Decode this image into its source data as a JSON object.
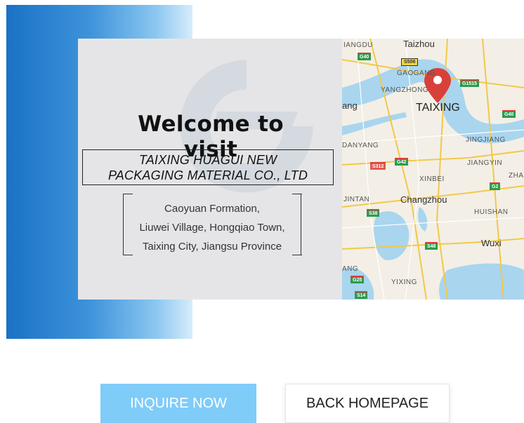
{
  "welcome": {
    "title": "Welcome to visit",
    "company_line1": "TAIXING HUAGUI NEW",
    "company_line2": "PACKAGING MATERIAL CO., LTD",
    "address_line1": "Caoyuan Formation,",
    "address_line2": "Liuwei Village, Hongqiao Town,",
    "address_line3": "Taixing City, Jiangsu Province"
  },
  "map": {
    "marker_label": "TAIXING",
    "labels": [
      "Taizhou",
      "IANGDU",
      "GAOGANG",
      "YANGZHONG",
      "ang",
      "JINGJIANG",
      "DANYANG",
      "JIANGYIN",
      "XINBEI",
      "ZHA",
      "JINTAN",
      "Changzhou",
      "HUISHAN",
      "Wuxi",
      "ANG",
      "YIXING"
    ],
    "shields": [
      "G40",
      "S506",
      "G1515",
      "G40",
      "G42",
      "S312",
      "G2",
      "S38",
      "S48",
      "G25",
      "S14"
    ]
  },
  "buttons": {
    "inquire": "INQUIRE NOW",
    "back": "BACK HOMEPAGE"
  },
  "colors": {
    "inquire_bg": "#7fccf9",
    "panel_blue": "#1a72c6",
    "marker_red": "#d8413a"
  }
}
